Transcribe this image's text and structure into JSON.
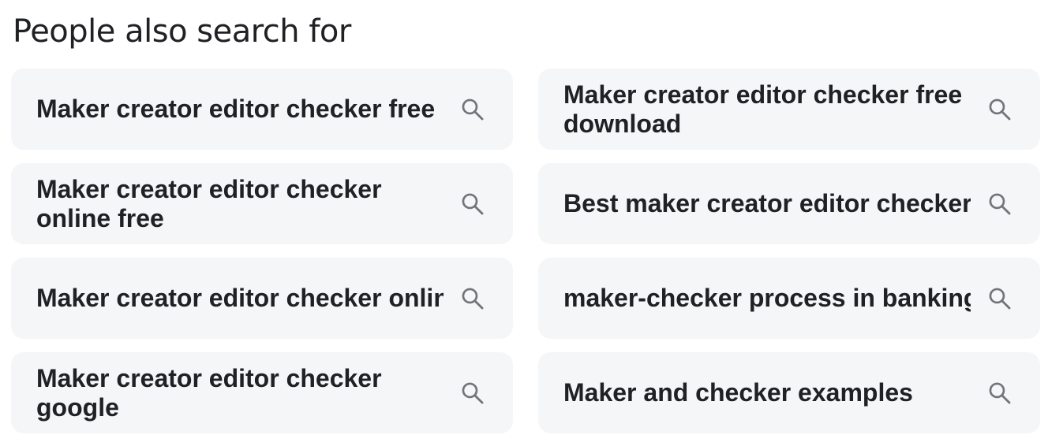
{
  "section": {
    "heading": "People also search for"
  },
  "related_searches": [
    {
      "text": "Maker creator editor checker free",
      "icon": "search-icon"
    },
    {
      "text": "Maker creator editor checker free download",
      "icon": "search-icon"
    },
    {
      "text": "Maker creator editor checker online free",
      "icon": "search-icon"
    },
    {
      "text": "Best maker creator editor checker",
      "icon": "search-icon"
    },
    {
      "text": "Maker creator editor checker online",
      "icon": "search-icon"
    },
    {
      "text": "maker-checker process in banking",
      "icon": "search-icon"
    },
    {
      "text": "Maker creator editor checker google",
      "icon": "search-icon"
    },
    {
      "text": "Maker and checker examples",
      "icon": "search-icon"
    }
  ],
  "colors": {
    "chip_background": "#f5f6f8",
    "text": "#202124",
    "icon": "#70757a"
  }
}
